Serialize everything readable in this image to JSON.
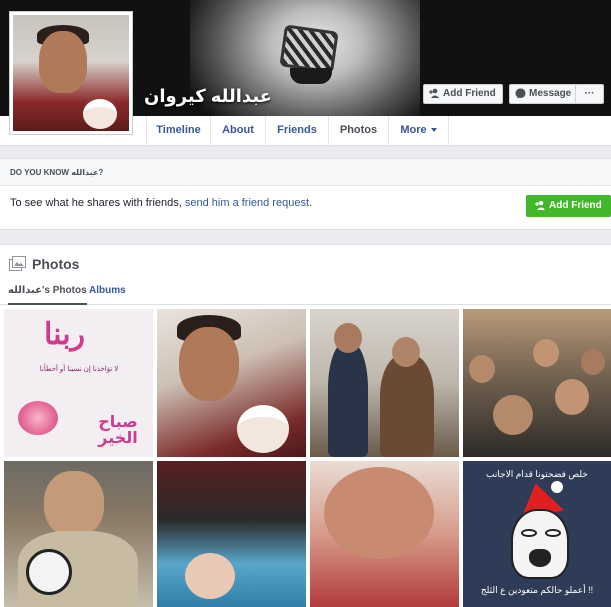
{
  "profile": {
    "name": "عبدالله كيروان"
  },
  "actions": {
    "add_friend": "Add Friend",
    "message": "Message",
    "more_dots": "···"
  },
  "tabs": [
    {
      "label": "Timeline"
    },
    {
      "label": "About"
    },
    {
      "label": "Friends"
    },
    {
      "label": "Photos"
    },
    {
      "label": "More"
    }
  ],
  "do_you_know": {
    "header": "DO YOU KNOW عبدالله?",
    "message_before": "To see what he shares with friends, ",
    "message_link": "send him a friend request.",
    "button": "Add Friend"
  },
  "photos": {
    "title": "Photos",
    "subtabs": [
      "عبدالله's Photos",
      "Albums"
    ],
    "tiles": [
      {
        "caption_top": "ربنا",
        "caption_small": "لا تؤاخذنا إن نسينا أو أخطأنا",
        "caption_bottom": "صباح الخير"
      },
      {},
      {},
      {},
      {},
      {},
      {},
      {
        "caption_top": "خلص فضحتونا قدام الاجانب",
        "caption_bottom": "أعملو حالكم متعودين ع الثلج !!"
      }
    ]
  },
  "colors": {
    "link": "#365899",
    "accent_green": "#42b72a",
    "cover_bg": "#111111"
  },
  "icons": [
    "add-friend-icon",
    "messenger-icon",
    "photos-icon",
    "chevron-down-icon"
  ]
}
